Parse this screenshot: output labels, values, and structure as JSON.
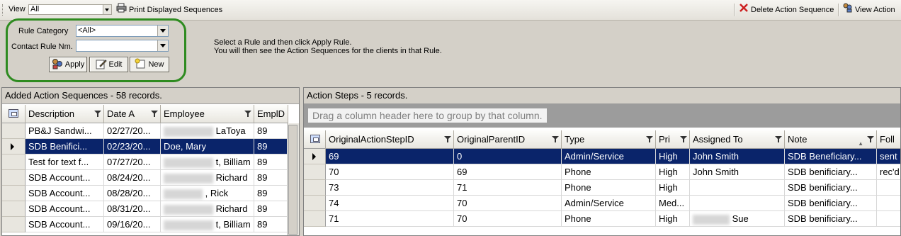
{
  "toolbar": {
    "view_label": "View",
    "view_value": "All",
    "print_label": "Print Displayed Sequences",
    "delete_label": "Delete Action Sequence",
    "view_action_label": "View Action"
  },
  "rule_panel": {
    "category_label": "Rule Category",
    "category_value": "<All>",
    "contact_label": "Contact Rule Nm.",
    "contact_value": "",
    "apply_label": "Apply",
    "edit_label": "Edit",
    "new_label": "New",
    "instruction_line1": "Select a Rule and then click Apply Rule.",
    "instruction_line2": "You will then see the Action Sequences for the clients in that Rule."
  },
  "sequences": {
    "caption": "Added Action Sequences - 58 records.",
    "columns": [
      "Description",
      "Date A",
      "Employee",
      "EmplD"
    ],
    "rows": [
      {
        "description": "PB&J  Sandwi...",
        "date": "02/27/20...",
        "employee": "LaToya",
        "emp_id": "89"
      },
      {
        "description": "SDB  Benifici...",
        "date": "02/23/20...",
        "employee": "Doe, Mary",
        "emp_id": "89"
      },
      {
        "description": "Test for text f...",
        "date": "07/27/20...",
        "employee": "t, Billiam",
        "emp_id": "89"
      },
      {
        "description": "SDB  Account...",
        "date": "08/24/20...",
        "employee": "Richard",
        "emp_id": "89"
      },
      {
        "description": "SDB  Account...",
        "date": "08/28/20...",
        "employee": ", Rick",
        "emp_id": "89"
      },
      {
        "description": "SDB  Account...",
        "date": "08/31/20...",
        "employee": "Richard",
        "emp_id": "89"
      },
      {
        "description": "SDB  Account...",
        "date": "09/16/20...",
        "employee": "t, Billiam",
        "emp_id": "89"
      }
    ],
    "selected_index": 1
  },
  "steps": {
    "caption": "Action Steps - 5 records.",
    "group_hint": "Drag a column header here to group by that column.",
    "columns": [
      "OriginalActionStepID",
      "OriginalParentID",
      "Type",
      "Pri",
      "Assigned To",
      "Note",
      "Foll"
    ],
    "rows": [
      {
        "step_id": "69",
        "parent_id": "0",
        "type": "Admin/Service",
        "pri": "High",
        "assigned": "John Smith",
        "note": "SDB  Beneficiary...",
        "foll": "sent"
      },
      {
        "step_id": "70",
        "parent_id": "69",
        "type": "Phone",
        "pri": "High",
        "assigned": "John Smith",
        "note": "SDB  benificiary...",
        "foll": "rec'd"
      },
      {
        "step_id": "73",
        "parent_id": "71",
        "type": "Phone",
        "pri": "High",
        "assigned": "",
        "note": "SDB  benificiary...",
        "foll": ""
      },
      {
        "step_id": "74",
        "parent_id": "70",
        "type": "Admin/Service",
        "pri": "Med...",
        "assigned": "",
        "note": "SDB  benificiary...",
        "foll": ""
      },
      {
        "step_id": "71",
        "parent_id": "70",
        "type": "Phone",
        "pri": "High",
        "assigned": "Sue",
        "note": "SDB  benificiary...",
        "foll": ""
      }
    ],
    "selected_index": 0
  },
  "colors": {
    "selection": "#0a246a",
    "highlight_ring": "#2e8b20",
    "delete_icon": "#cc1f1f"
  }
}
